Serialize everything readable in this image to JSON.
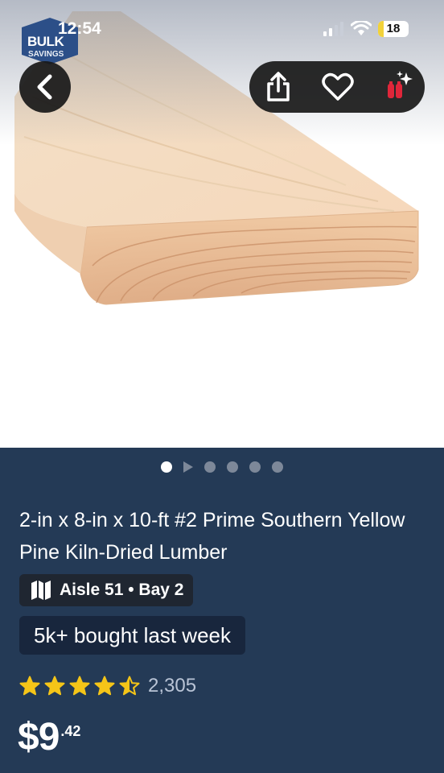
{
  "status_bar": {
    "time": "12:54",
    "battery": "18",
    "battery_level": 0.18
  },
  "badge": {
    "line1": "BULK",
    "line2": "SAVINGS"
  },
  "product": {
    "title": "2-in x 8-in x 10-ft #2 Prime Southern Yellow Pine Kiln-Dried Lumber",
    "location": "Aisle 51 • Bay 2",
    "bought": "5k+ bought last week",
    "rating": 4.5,
    "review_count": "2,305",
    "price_main": "$9",
    "price_cents": ".42"
  },
  "carousel": {
    "image_count": 6,
    "active_index": 0
  },
  "icons": {
    "back": "chevron-left-icon",
    "share": "share-icon",
    "favorite": "heart-icon",
    "ai": "sparkle-icon",
    "location": "map-icon",
    "star": "star-icon"
  },
  "colors": {
    "panel": "#243a56",
    "star": "#f5c518",
    "accent_red": "#e0263a"
  }
}
